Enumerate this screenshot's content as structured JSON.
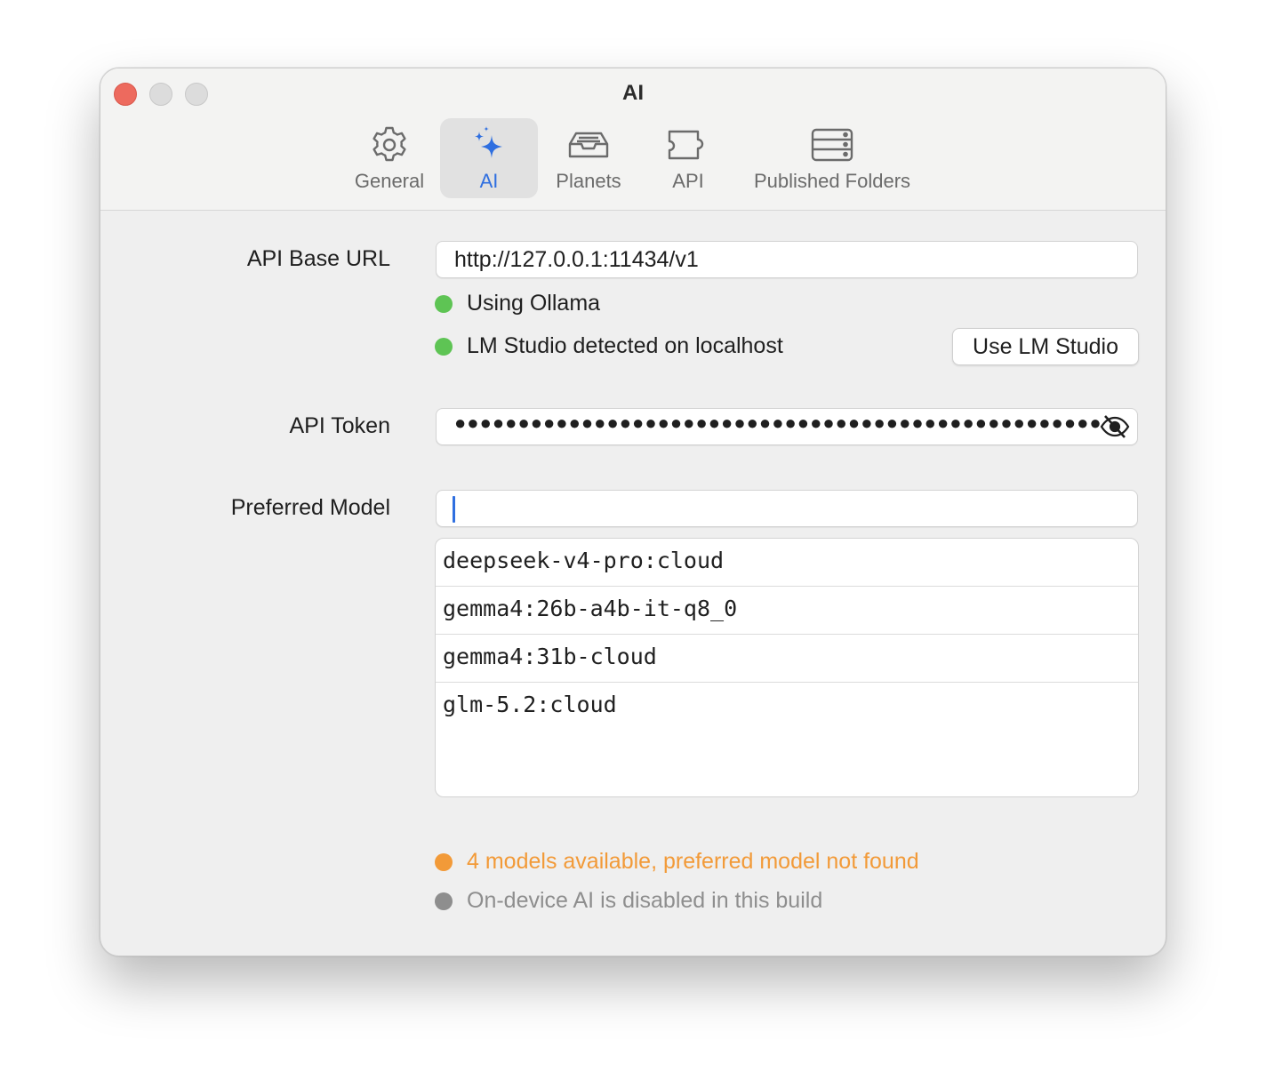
{
  "window": {
    "title": "AI"
  },
  "tabs": [
    {
      "label": "General",
      "icon": "gear-icon"
    },
    {
      "label": "AI",
      "icon": "sparkles-icon"
    },
    {
      "label": "Planets",
      "icon": "tray-icon"
    },
    {
      "label": "API",
      "icon": "puzzle-icon"
    },
    {
      "label": "Published Folders",
      "icon": "server-rack-icon"
    }
  ],
  "active_tab": "AI",
  "form": {
    "api_base_url": {
      "label": "API Base URL",
      "value": "http://127.0.0.1:11434/v1"
    },
    "status_ollama": {
      "text": "Using Ollama",
      "color": "#5ec454"
    },
    "status_lmstudio": {
      "text": "LM Studio detected on localhost",
      "color": "#5ec454"
    },
    "use_lmstudio_button": "Use LM Studio",
    "api_token": {
      "label": "API Token",
      "masked": "●●●●●●●●●●●●●●●●●●●●●●●●●●●●●●●●●●●●●●●●●●●●●●●●●●●●●"
    },
    "preferred_model": {
      "label": "Preferred Model",
      "value": ""
    },
    "models": [
      "deepseek-v4-pro:cloud",
      "gemma4:26b-a4b-it-q8_0",
      "gemma4:31b-cloud",
      "glm-5.2:cloud"
    ],
    "status_models": {
      "text": "4 models available, preferred model not found",
      "color": "#f29a38"
    },
    "status_ondevice": {
      "text": "On-device AI is disabled in this build",
      "color": "#8e8e8e"
    }
  },
  "colors": {
    "accent": "#2f6fe0",
    "close": "#ed6a5e"
  }
}
